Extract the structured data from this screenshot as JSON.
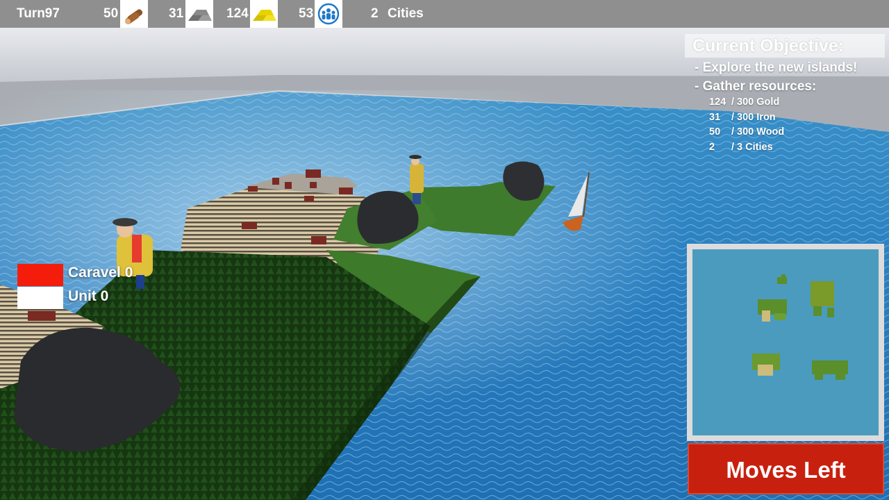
{
  "topbar": {
    "turn": "Turn97",
    "wood_value": "50",
    "iron_value": "31",
    "gold_value": "124",
    "population_value": "53",
    "cities_value": "2",
    "cities_label": "Cities",
    "icons": [
      "wood-logs-icon",
      "iron-ingot-icon",
      "gold-ingot-icon",
      "population-icon"
    ]
  },
  "objective": {
    "title": "Current Objective:",
    "lines": [
      "- Explore the new islands!",
      "- Gather resources:"
    ],
    "resources": [
      {
        "current": "124",
        "target": "/ 300 Gold"
      },
      {
        "current": "31",
        "target": "/ 300 Iron"
      },
      {
        "current": "50",
        "target": "/ 300 Wood"
      },
      {
        "current": "2",
        "target": "/ 3 Cities"
      }
    ]
  },
  "legend": {
    "caravel_label": "Caravel 0",
    "unit_label": "Unit 0",
    "caravel_color": "#f41d0c",
    "unit_color": "#ffffff"
  },
  "moves_button": {
    "label": "Moves Left",
    "color": "#c8200f"
  },
  "colors": {
    "water": "#2a7fbf",
    "grass": "#3f7a2a",
    "forest": "#173a12",
    "rock": "#2b2c30"
  }
}
